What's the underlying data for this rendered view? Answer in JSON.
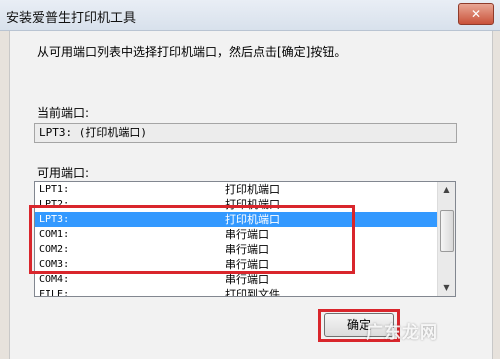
{
  "window": {
    "title": "安装爱普生打印机工具",
    "close_glyph": "✕"
  },
  "instruction": "从可用端口列表中选择打印机端口，然后点击[确定]按钮。",
  "current_port": {
    "label": "当前端口:",
    "value": "LPT3: (打印机端口)"
  },
  "available_ports": {
    "label": "可用端口:",
    "items": [
      {
        "port": "LPT1:",
        "desc": "打印机端口"
      },
      {
        "port": "LPT2:",
        "desc": "打印机端口"
      },
      {
        "port": "LPT3:",
        "desc": "打印机端口",
        "selected": true
      },
      {
        "port": "COM1:",
        "desc": "串行端口"
      },
      {
        "port": "COM2:",
        "desc": "串行端口"
      },
      {
        "port": "COM3:",
        "desc": "串行端口"
      },
      {
        "port": "COM4:",
        "desc": "串行端口"
      },
      {
        "port": "FILE:",
        "desc": "打印到文件"
      }
    ]
  },
  "buttons": {
    "ok": "确定"
  },
  "watermark": "广东龙网",
  "colors": {
    "selection": "#3399ff",
    "highlight_annotation": "#d9262c"
  },
  "icons": {
    "scroll_up": "up-arrow-icon",
    "scroll_down": "down-arrow-icon"
  }
}
